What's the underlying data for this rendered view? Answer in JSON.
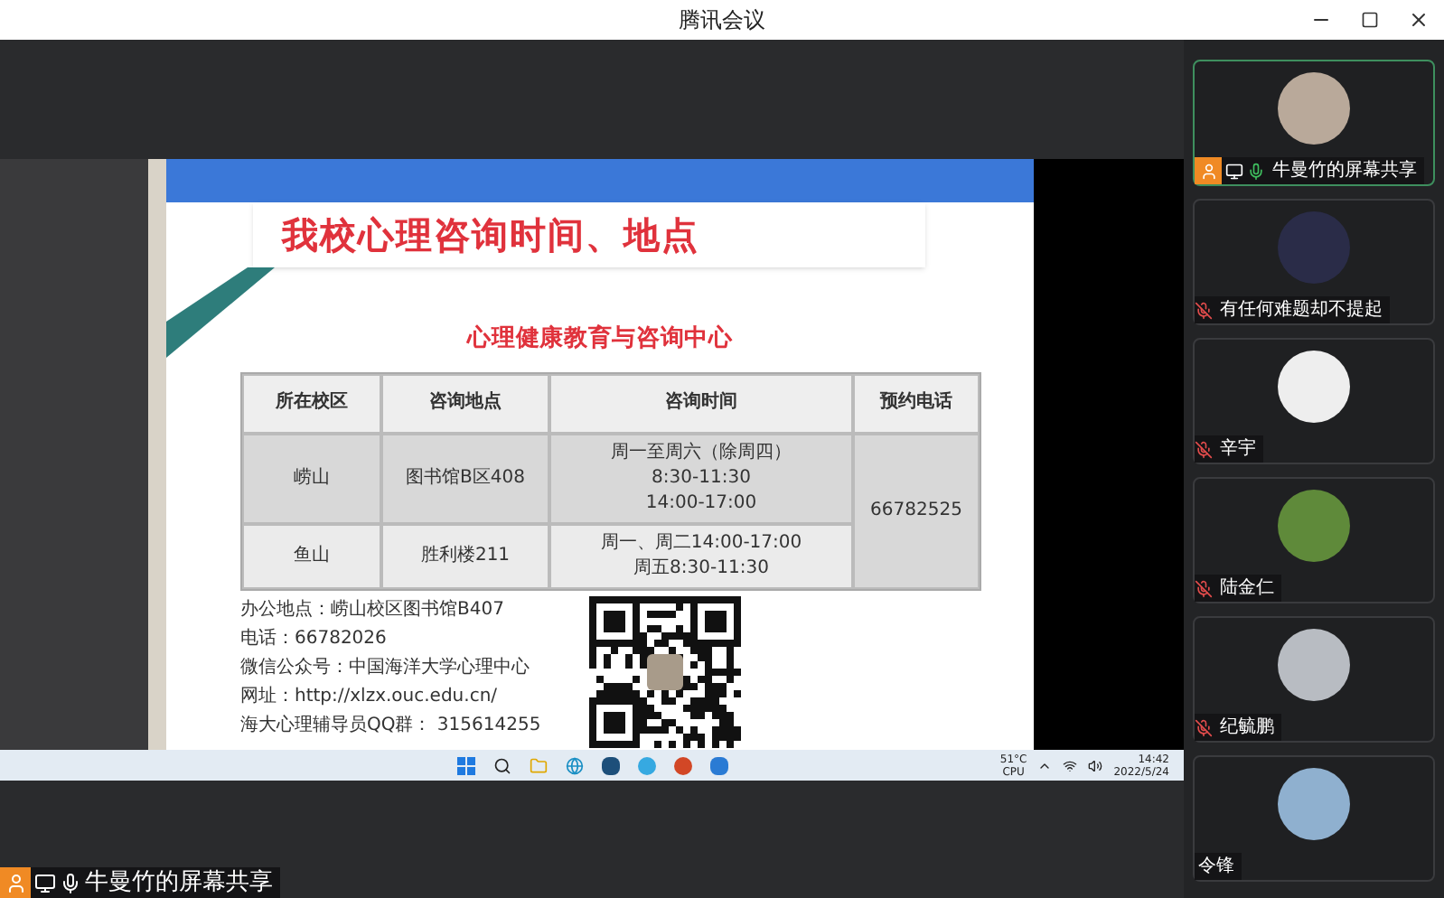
{
  "window": {
    "title": "腾讯会议"
  },
  "shared_screen": {
    "slide": {
      "title": "我校心理咨询时间、地点",
      "subtitle": "心理健康教育与咨询中心",
      "table": {
        "columns": [
          "所在校区",
          "咨询地点",
          "咨询时间",
          "预约电话"
        ],
        "rows": [
          {
            "campus": "崂山",
            "location": "图书馆B区408",
            "hours": [
              "周一至周六（除周四）",
              "8:30-11:30",
              "14:00-17:00"
            ]
          },
          {
            "campus": "鱼山",
            "location": "胜利楼211",
            "hours": [
              "周一、周二14:00-17:00",
              "周五8:30-11:30"
            ]
          }
        ],
        "phone": "66782525"
      },
      "contact_lines": [
        "办公地点：崂山校区图书馆B407",
        "电话：66782026",
        "微信公众号：中国海洋大学心理中心",
        "网址：http://xlzx.ouc.edu.cn/",
        "海大心理辅导员QQ群： 315614255"
      ]
    },
    "taskbar": {
      "cpu_temp": "51°C",
      "cpu_label": "CPU",
      "time": "14:42",
      "date": "2022/5/24"
    }
  },
  "sharer_label": "牛曼竹的屏幕共享",
  "participants": [
    {
      "name": "牛曼竹的屏幕共享",
      "kind": "sharer",
      "active": true
    },
    {
      "name": "有任何难题却不提起",
      "kind": "muted",
      "active": false
    },
    {
      "name": "辛宇",
      "kind": "muted",
      "active": false
    },
    {
      "name": "陆金仁",
      "kind": "muted",
      "active": false
    },
    {
      "name": "纪毓鹏",
      "kind": "muted",
      "active": false
    },
    {
      "name": "令锋",
      "kind": "plain",
      "active": false
    }
  ]
}
